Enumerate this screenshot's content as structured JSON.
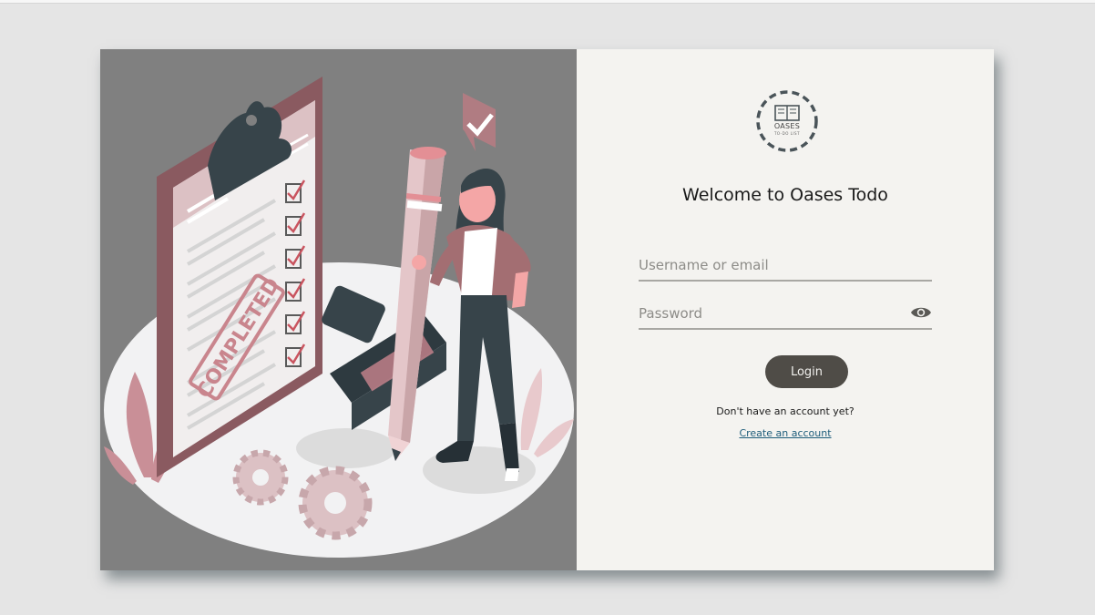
{
  "logo": {
    "line1": "OASES",
    "line2": "TO-DO LIST"
  },
  "title": "Welcome to Oases Todo",
  "form": {
    "username_placeholder": "Username or email",
    "password_placeholder": "Password",
    "password_toggle_icon": "eye-icon",
    "login_label": "Login"
  },
  "signup": {
    "prompt": "Don't have an account yet?",
    "link_label": "Create an account"
  },
  "illustration": {
    "stamp_text": "COMPLETED",
    "icons": [
      "clipboard-icon",
      "checkmark-icon",
      "pencil-icon",
      "gear-icon",
      "stamp-icon"
    ]
  },
  "colors": {
    "page_bg": "#e5e5e5",
    "illustration_bg": "#808080",
    "panel_bg": "#f4f3f0",
    "button_bg": "#4f4c47",
    "link": "#1d5c7a",
    "accent_pink": "#c9a5a8"
  }
}
